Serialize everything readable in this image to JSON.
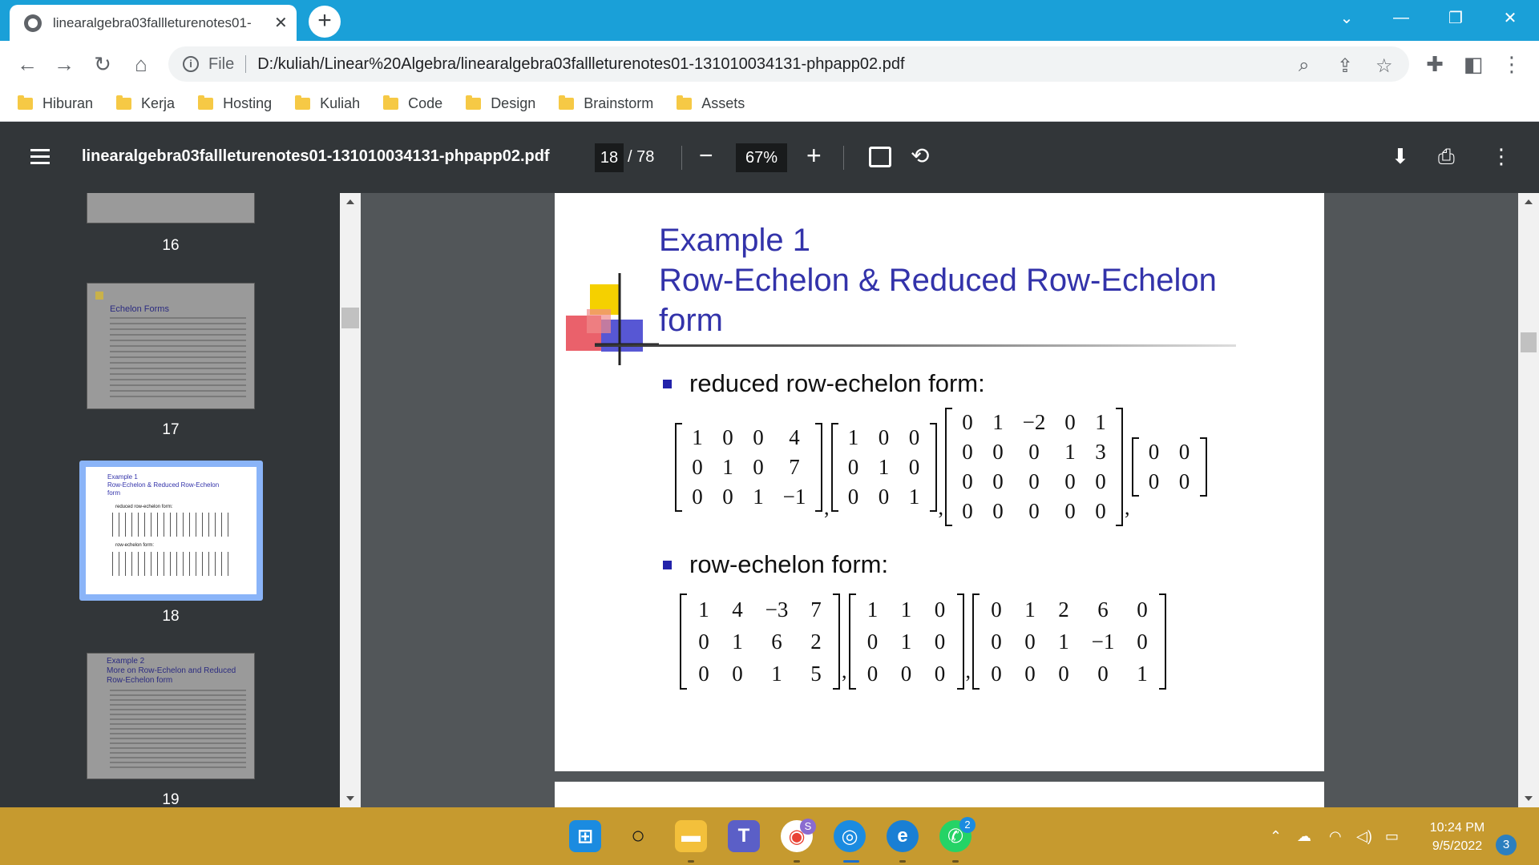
{
  "browser": {
    "tab_title": "linearalgebra03fallleturenotes01-",
    "address_scheme": "File",
    "url": "D:/kuliah/Linear%20Algebra/linearalgebra03fallleturenotes01-131010034131-phpapp02.pdf",
    "bookmarks": [
      "Hiburan",
      "Kerja",
      "Hosting",
      "Kuliah",
      "Code",
      "Design",
      "Brainstorm",
      "Assets"
    ]
  },
  "pdf": {
    "filename": "linearalgebra03fallleturenotes01-131010034131-phpapp02.pdf",
    "current_page": "18",
    "total_pages": "/ 78",
    "zoom": "67%"
  },
  "sidebar": {
    "page_numbers": [
      "16",
      "17",
      "18",
      "19"
    ],
    "thumb17_title": "Echelon Forms",
    "thumb18_title": "Example 1\nRow-Echelon & Reduced Row-Echelon\nform",
    "thumb18_b1": "reduced row-echelon form:",
    "thumb18_b2": "row-echelon form:",
    "thumb19_title": "Example 2\nMore on Row-Echelon and Reduced\nRow-Echelon form"
  },
  "slide": {
    "title_line1": "Example 1",
    "title_line2": "Row-Echelon & Reduced Row-Echelon",
    "title_line3": "form",
    "bullet1": "reduced row-echelon form:",
    "bullet2": "row-echelon form:",
    "rref_matrices": [
      [
        [
          "1",
          "0",
          "0",
          "4"
        ],
        [
          "0",
          "1",
          "0",
          "7"
        ],
        [
          "0",
          "0",
          "1",
          "−1"
        ]
      ],
      [
        [
          "1",
          "0",
          "0"
        ],
        [
          "0",
          "1",
          "0"
        ],
        [
          "0",
          "0",
          "1"
        ]
      ],
      [
        [
          "0",
          "1",
          "−2",
          "0",
          "1"
        ],
        [
          "0",
          "0",
          "0",
          "1",
          "3"
        ],
        [
          "0",
          "0",
          "0",
          "0",
          "0"
        ],
        [
          "0",
          "0",
          "0",
          "0",
          "0"
        ]
      ],
      [
        [
          "0",
          "0"
        ],
        [
          "0",
          "0"
        ]
      ]
    ],
    "ref_matrices": [
      [
        [
          "1",
          "4",
          "−3",
          "7"
        ],
        [
          "0",
          "1",
          "6",
          "2"
        ],
        [
          "0",
          "0",
          "1",
          "5"
        ]
      ],
      [
        [
          "1",
          "1",
          "0"
        ],
        [
          "0",
          "1",
          "0"
        ],
        [
          "0",
          "0",
          "0"
        ]
      ],
      [
        [
          "0",
          "1",
          "2",
          "6",
          "0"
        ],
        [
          "0",
          "0",
          "1",
          "−1",
          "0"
        ],
        [
          "0",
          "0",
          "0",
          "0",
          "1"
        ]
      ]
    ]
  },
  "taskbar": {
    "time": "10:24 PM",
    "date": "9/5/2022",
    "notification_count": "3",
    "chrome_badge": "S",
    "whatsapp_badge": "2"
  },
  "colors": {
    "titlebar": "#1aa0d8",
    "pdf_toolbar": "#323639",
    "slide_title": "#3333aa",
    "taskbar": "#c69a2f"
  }
}
